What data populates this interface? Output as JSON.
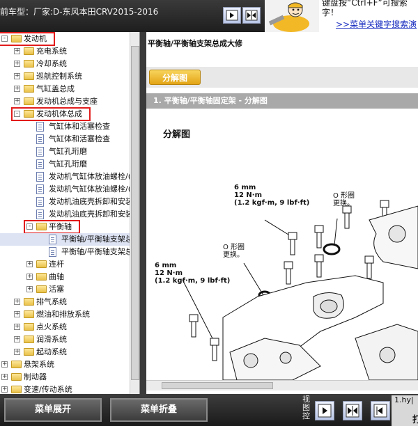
{
  "header": {
    "car_title": "前车型：厂家:D-东风本田CRV2015-2016",
    "hint_line1": "键盘按“Ctrl+F”可搜索",
    "hint_line2": "字！",
    "hint_link": ">>菜单关键字搜索演"
  },
  "tree": {
    "items": [
      {
        "label": "发动机",
        "level": 0,
        "type": "folder",
        "state": "-",
        "highlight": true
      },
      {
        "label": "充电系统",
        "level": 1,
        "type": "folder",
        "state": "+"
      },
      {
        "label": "冷却系统",
        "level": 1,
        "type": "folder",
        "state": "+"
      },
      {
        "label": "巡航控制系统",
        "level": 1,
        "type": "folder",
        "state": "+"
      },
      {
        "label": "气缸盖总成",
        "level": 1,
        "type": "folder",
        "state": "+"
      },
      {
        "label": "发动机总成与支座",
        "level": 1,
        "type": "folder",
        "state": "+"
      },
      {
        "label": "发动机体总成",
        "level": 1,
        "type": "folder",
        "state": "-",
        "highlight": true
      },
      {
        "label": "气缸体和活塞检查",
        "level": 2,
        "type": "doc"
      },
      {
        "label": "气缸体和活塞检查",
        "level": 2,
        "type": "doc"
      },
      {
        "label": "气缸孔珩磨",
        "level": 2,
        "type": "doc"
      },
      {
        "label": "气缸孔珩磨",
        "level": 2,
        "type": "doc"
      },
      {
        "label": "发动机气缸体放油螺栓/(",
        "level": 2,
        "type": "doc"
      },
      {
        "label": "发动机气缸体放油螺栓/(",
        "level": 2,
        "type": "doc"
      },
      {
        "label": "发动机油底壳拆卸和安装",
        "level": 2,
        "type": "doc"
      },
      {
        "label": "发动机油底壳拆卸和安装",
        "level": 2,
        "type": "doc"
      },
      {
        "label": "平衡轴",
        "level": 2,
        "type": "folder",
        "state": "-",
        "highlight": true
      },
      {
        "label": "平衡轴/平衡轴支架总",
        "level": 3,
        "type": "doc",
        "selected": true
      },
      {
        "label": "平衡轴/平衡轴支架总",
        "level": 3,
        "type": "doc"
      },
      {
        "label": "连杆",
        "level": 2,
        "type": "folder",
        "state": "+"
      },
      {
        "label": "曲轴",
        "level": 2,
        "type": "folder",
        "state": "+"
      },
      {
        "label": "活塞",
        "level": 2,
        "type": "folder",
        "state": "+"
      },
      {
        "label": "排气系统",
        "level": 1,
        "type": "folder",
        "state": "+"
      },
      {
        "label": "燃油和排放系统",
        "level": 1,
        "type": "folder",
        "state": "+"
      },
      {
        "label": "点火系统",
        "level": 1,
        "type": "folder",
        "state": "+"
      },
      {
        "label": "润滑系统",
        "level": 1,
        "type": "folder",
        "state": "+"
      },
      {
        "label": "起动系统",
        "level": 1,
        "type": "folder",
        "state": "+"
      },
      {
        "label": "悬架系统",
        "level": 0,
        "type": "folder",
        "state": "+"
      },
      {
        "label": "制动器",
        "level": 0,
        "type": "folder",
        "state": "+"
      },
      {
        "label": "变速/传动系统",
        "level": 0,
        "type": "folder",
        "state": "+"
      }
    ]
  },
  "content": {
    "page_title": "平衡轴/平衡轴支架总成大修",
    "tab_label": "分解图",
    "section_title": "1. 平衡轴/平衡轴固定架 - 分解图",
    "diagram_title": "分解图",
    "annotations": {
      "torque1_l1": "6 mm",
      "torque1_l2": "12 N·m",
      "torque1_l3": "(1.2 kgf·m, 9 lbf·ft)",
      "oring1_l1": "O 形圈",
      "oring1_l2": "更换。",
      "oring2_l1": "O 形圈",
      "oring2_l2": "更换。",
      "torque2_l1": "6 mm",
      "torque2_l2": "12 N·m",
      "torque2_l3": "(1.2 kgf·m, 9 lbf·ft)"
    }
  },
  "footer": {
    "expand_label": "菜单展开",
    "collapse_label": "菜单折叠",
    "view_label": "视图控",
    "edge_text": "1.hy|",
    "edge_text2": "打"
  }
}
